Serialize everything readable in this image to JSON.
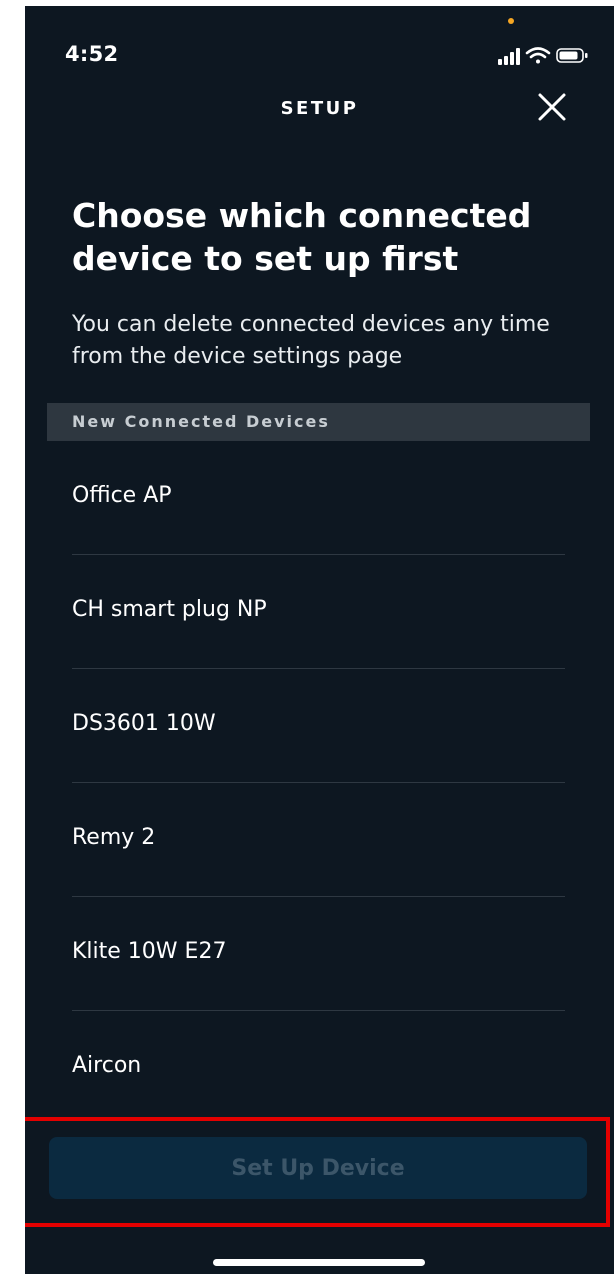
{
  "status_bar": {
    "time": "4:52"
  },
  "header": {
    "title": "SETUP",
    "close_icon": "close-icon"
  },
  "heading": "Choose which connected device to set up first",
  "subtext": "You can delete connected devices any time from the device settings page",
  "section": {
    "title": "New Connected Devices"
  },
  "devices": [
    {
      "label": "Office AP"
    },
    {
      "label": "CH smart plug NP"
    },
    {
      "label": "DS3601 10W"
    },
    {
      "label": "Remy 2"
    },
    {
      "label": "Klite 10W E27"
    },
    {
      "label": "Aircon"
    }
  ],
  "actions": {
    "setup_label": "Set Up Device",
    "setup_enabled": false
  },
  "colors": {
    "background": "#0d1721",
    "section_bg": "#2e3740",
    "button_bg": "#0b2a40",
    "button_text_disabled": "#3c5669",
    "highlight": "#e30000",
    "recording_dot": "#f5a623"
  }
}
